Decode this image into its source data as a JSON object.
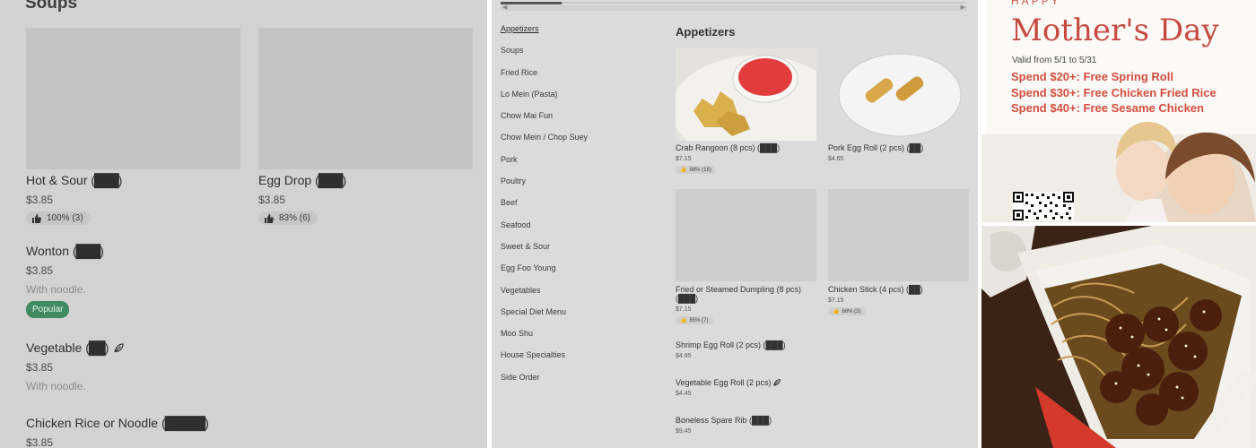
{
  "soups_panel": {
    "section_title": "Soups",
    "items": [
      {
        "name": "Hot & Sour",
        "name_glyph": "(███)",
        "price": "$3.85",
        "rating": "100% (3)"
      },
      {
        "name": "Egg Drop",
        "name_glyph": "(███)",
        "price": "$3.85",
        "rating": "83% (6)"
      },
      {
        "name": "Wonton",
        "name_glyph": "(███)",
        "price": "$3.85",
        "description": "With noodle.",
        "badge": "Popular"
      },
      {
        "name": "Vegetable",
        "name_glyph": "(██)",
        "price": "$3.85",
        "description": "With noodle.",
        "icon": "leaf-icon"
      },
      {
        "name": "Chicken Rice or Noodle",
        "name_glyph": "(█████)",
        "price": "$3.85"
      }
    ]
  },
  "menu_panel": {
    "categories": [
      "Appetizers",
      "Soups",
      "Fried Rice",
      "Lo Mein (Pasta)",
      "Chow Mai Fun",
      "Chow Mein / Chop Suey",
      "Pork",
      "Poultry",
      "Beef",
      "Seafood",
      "Sweet & Sour",
      "Egg Foo Young",
      "Vegetables",
      "Special Diet Menu",
      "Moo Shu",
      "House Specialties",
      "Side Order"
    ],
    "active_category": "Appetizers",
    "section_title": "Appetizers",
    "items": [
      {
        "name": "Crab Rangoon (8 pcs) (███)",
        "price": "$7.15",
        "rating": "88% (18)"
      },
      {
        "name": "Pork Egg Roll (2 pcs) (██)",
        "price": "$4.65"
      },
      {
        "name": "Fried or Steamed Dumpling (8 pcs) (███)",
        "price": "$7.15",
        "rating": "85% (7)"
      },
      {
        "name": "Chicken Stick (4 pcs) (██)",
        "price": "$7.15",
        "rating": "66% (3)"
      },
      {
        "name": "Shrimp Egg Roll (2 pcs) (███)",
        "price": "$4.95"
      },
      {
        "name": "Vegetable Egg Roll (2 pcs)",
        "price": "$4.45",
        "icon": "leaf-icon"
      },
      {
        "name": "Boneless Spare Rib (███)",
        "price": "$9.45"
      }
    ]
  },
  "promo_ad": {
    "eyebrow": "HAPPY",
    "title": "Mother's Day",
    "valid": "Valid from 5/1 to 5/31",
    "deals": [
      "Spend $20+: Free Spring Roll",
      "Spend $30+: Free Chicken Fried Rice",
      "Spend $40+: Free Sesame Chicken"
    ],
    "qr_icon": "qr-code-icon"
  },
  "food_photo": {
    "subject": "sesame-chicken-lo-mein-photo"
  },
  "colors": {
    "popular_badge": "#3f8a60",
    "promo_red": "#d44d3f",
    "panel_gray": "#d2d2d2"
  }
}
